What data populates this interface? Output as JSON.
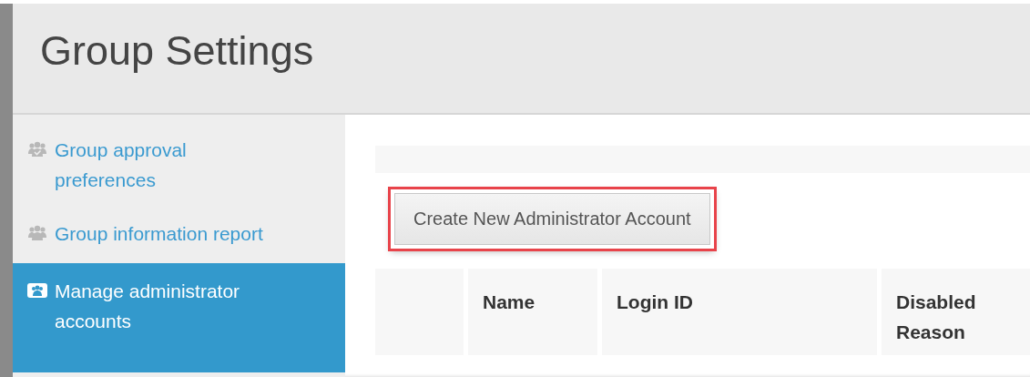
{
  "header": {
    "title": "Group Settings"
  },
  "sidebar": {
    "items": [
      {
        "label": "Group approval preferences",
        "selected": false
      },
      {
        "label": "Group information report",
        "selected": false
      },
      {
        "label": "Manage administrator accounts",
        "selected": true
      }
    ]
  },
  "main": {
    "create_button": {
      "label": "Create New Administrator Account",
      "highlighted": true
    },
    "table": {
      "columns": [
        "",
        "Name",
        "Login ID",
        "Disabled Reason"
      ]
    }
  }
}
